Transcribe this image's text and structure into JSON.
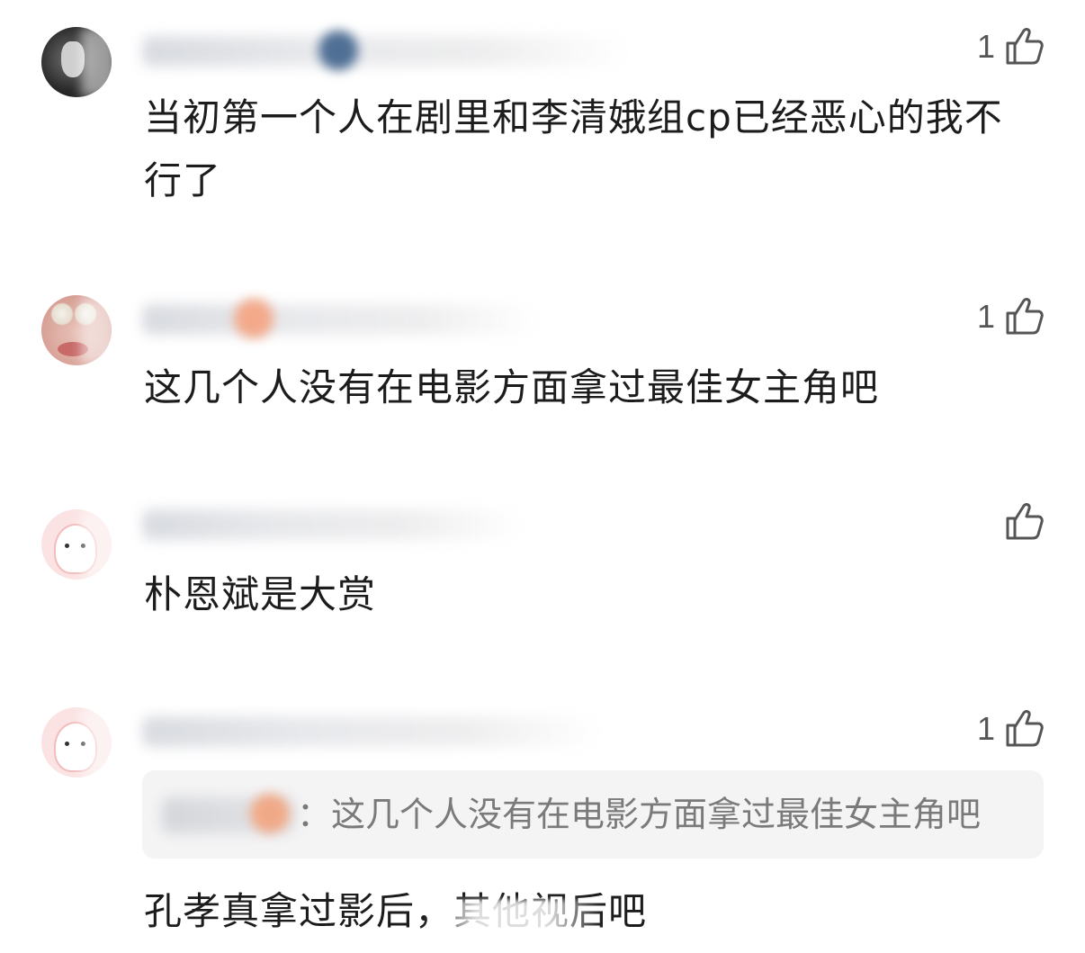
{
  "comments": [
    {
      "likes": "1",
      "text": "当初第一个人在剧里和李清娥组cp已经恶心的我不行了"
    },
    {
      "likes": "1",
      "text": "这几个人没有在电影方面拿过最佳女主角吧"
    },
    {
      "likes": "",
      "text": "朴恩斌是大赏"
    },
    {
      "likes": "1",
      "quote": "：这几个人没有在电影方面拿过最佳女主角吧",
      "text": "孔孝真拿过影后，其他视后吧"
    }
  ],
  "colors": {
    "text": "#1c1c1c",
    "secondary": "#7a7a7a",
    "quote_bg": "#f4f4f5"
  },
  "icons": [
    "thumbs-up-icon"
  ]
}
